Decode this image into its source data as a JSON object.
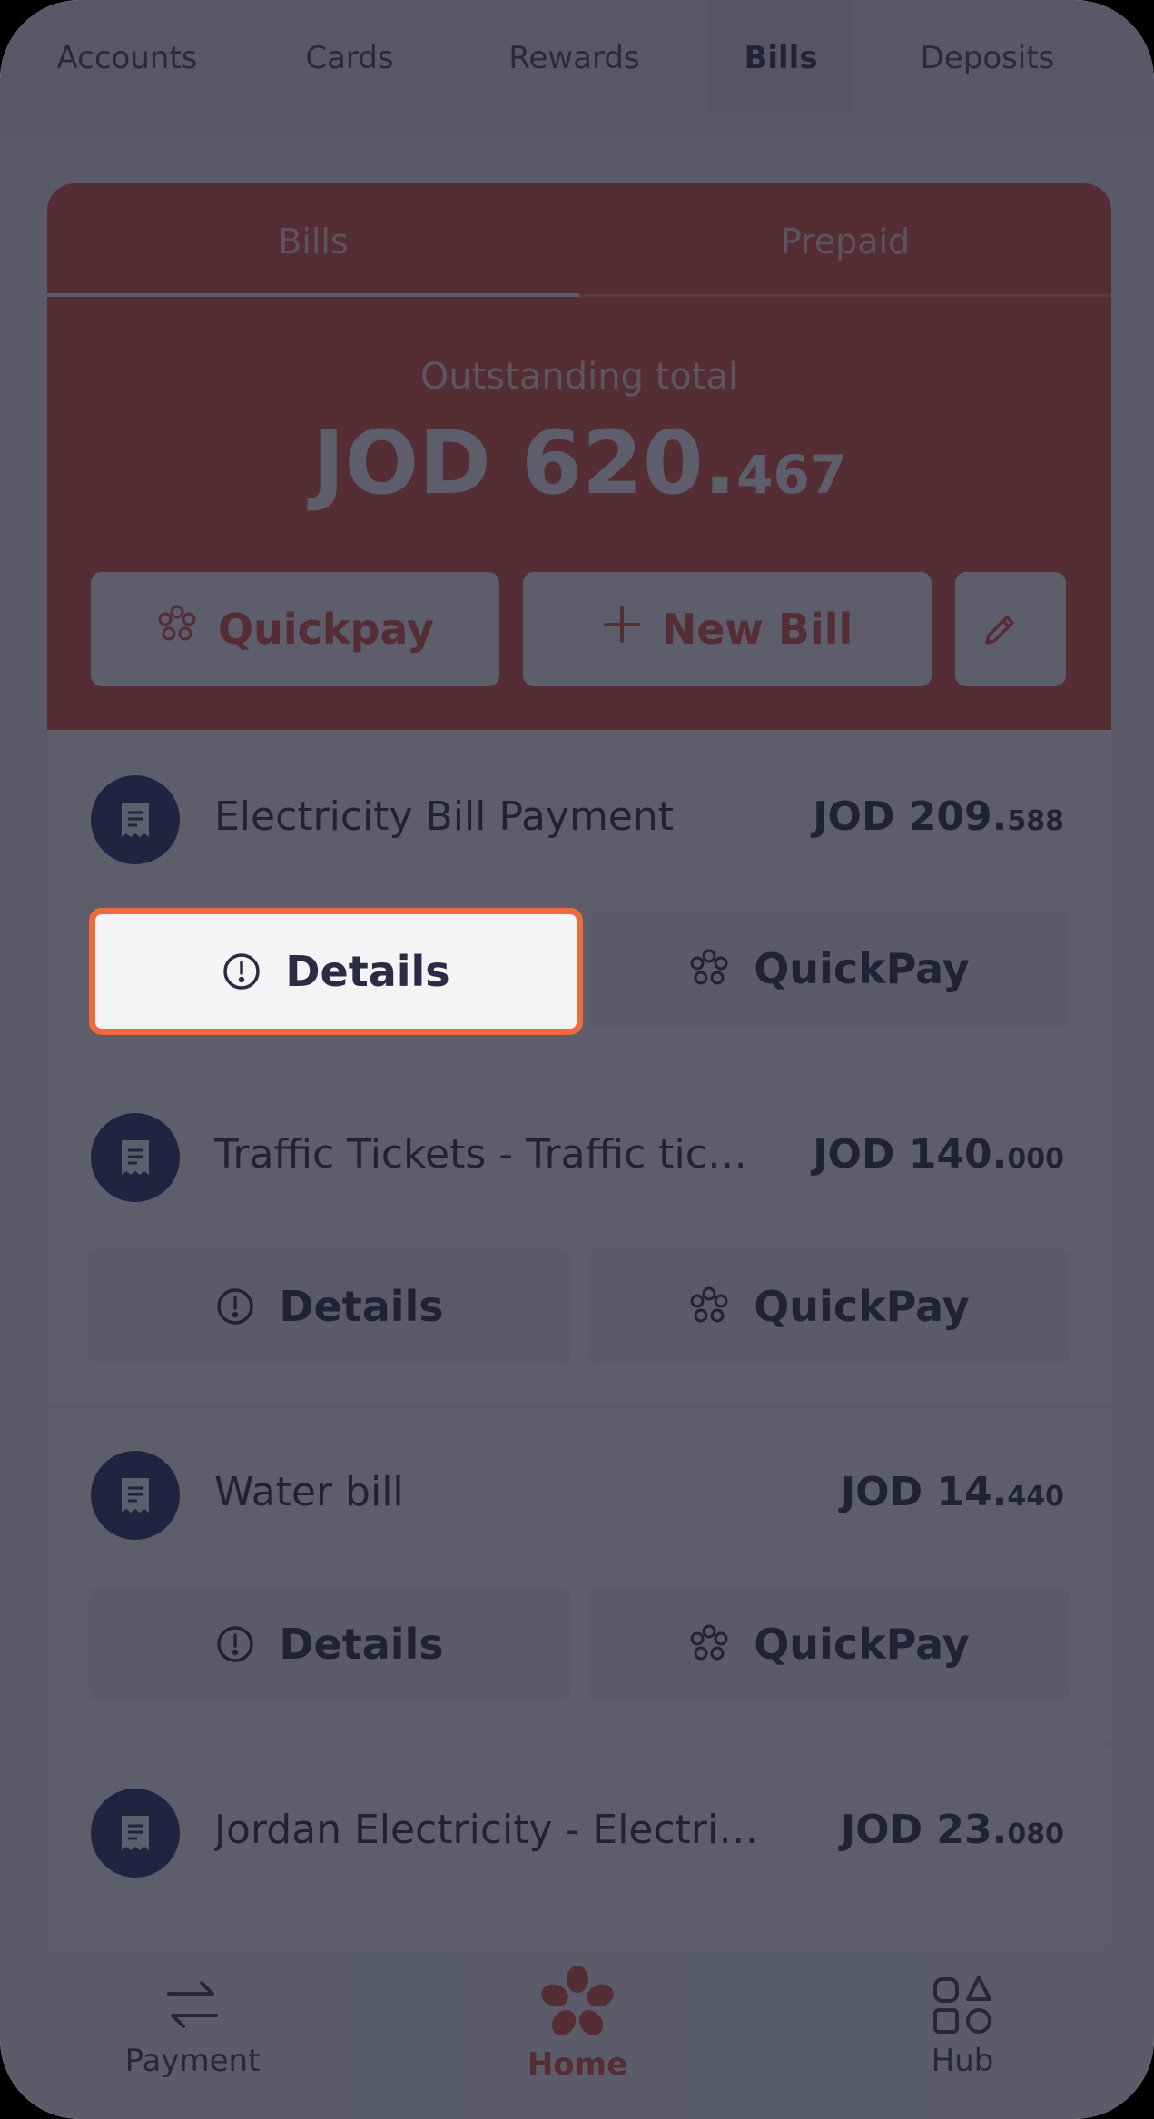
{
  "top_tabs": [
    "Accounts",
    "Cards",
    "Rewards",
    "Bills",
    "Deposits"
  ],
  "bills_tabs": [
    "Bills",
    "Prepaid"
  ],
  "summary": {
    "label": "Outstanding total",
    "currency": "JOD",
    "amount_int": "620.",
    "amount_dec": "467"
  },
  "actions": {
    "quickpay": "Quickpay",
    "new_bill": "New Bill"
  },
  "bills": [
    {
      "name": "Electricity Bill Payment",
      "amount_int": "JOD 209.",
      "amount_dec": "588",
      "details": "Details",
      "quickpay": "QuickPay"
    },
    {
      "name": "Traffic Tickets - Traffic tic…",
      "amount_int": "JOD 140.",
      "amount_dec": "000",
      "details": "Details",
      "quickpay": "QuickPay"
    },
    {
      "name": "Water bill",
      "amount_int": "JOD 14.",
      "amount_dec": "440",
      "details": "Details",
      "quickpay": "QuickPay"
    },
    {
      "name": "Jordan Electricity - Electri…",
      "amount_int": "JOD 23.",
      "amount_dec": "080"
    }
  ],
  "bottom_nav": {
    "payment": "Payment",
    "home": "Home",
    "hub": "Hub"
  },
  "colors": {
    "brand": "#e3523a",
    "navy": "#2d2f66",
    "highlight": "#ee6a3b"
  }
}
